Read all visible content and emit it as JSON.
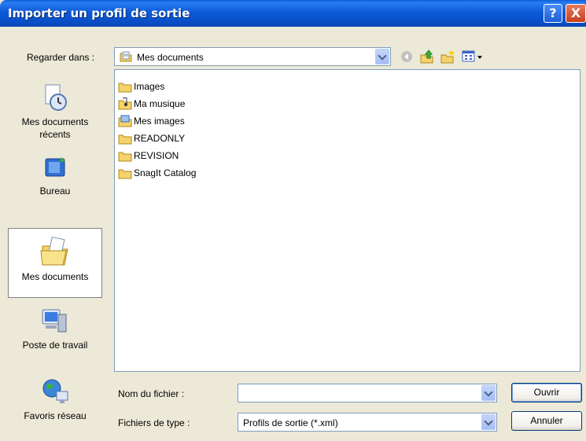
{
  "window": {
    "title": "Importer un profil de sortie",
    "help": "?",
    "close": "X"
  },
  "lookin": {
    "label": "Regarder dans :",
    "value": "Mes documents"
  },
  "places": [
    {
      "label": "Mes documents récents"
    },
    {
      "label": "Bureau"
    },
    {
      "label": "Mes documents"
    },
    {
      "label": "Poste de travail"
    },
    {
      "label": "Favoris réseau"
    }
  ],
  "files": [
    {
      "name": "Images",
      "icon": "folder-icon"
    },
    {
      "name": "Ma musique",
      "icon": "music-folder-icon"
    },
    {
      "name": "Mes images",
      "icon": "pictures-folder-icon"
    },
    {
      "name": "READONLY",
      "icon": "folder-icon"
    },
    {
      "name": "REVISION",
      "icon": "folder-icon"
    },
    {
      "name": "SnagIt Catalog",
      "icon": "folder-icon"
    }
  ],
  "filename": {
    "label": "Nom du fichier :",
    "value": ""
  },
  "filetype": {
    "label": "Fichiers de type :",
    "value": "Profils de sortie (*.xml)"
  },
  "buttons": {
    "open": "Ouvrir",
    "cancel": "Annuler"
  },
  "colors": {
    "titlebar": "#0a4fc8",
    "dialog_bg": "#ece9d8",
    "field_border": "#7f9db9"
  }
}
